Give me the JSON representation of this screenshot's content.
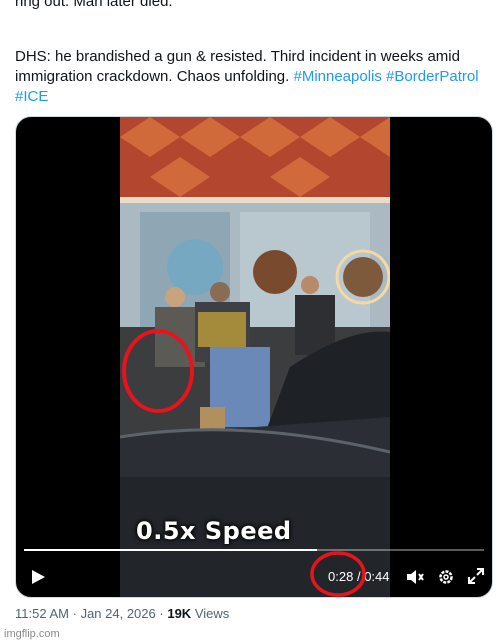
{
  "tweet": {
    "line_cut": "ring out. Man later died.",
    "para2_text": "DHS: he brandished a gun & resisted. Third incident in weeks amid immigration crackdown. Chaos unfolding.",
    "hashtags": [
      "#Minneapolis",
      "#BorderPatrol",
      "#ICE"
    ]
  },
  "video": {
    "overlay_text": "0.5x Speed",
    "current_time": "0:28",
    "separator": "/",
    "duration": "0:44",
    "progress": 0.636,
    "icons": {
      "play": "play-icon",
      "volume": "volume-icon",
      "settings": "gear-icon",
      "fullscreen": "expand-icon"
    },
    "annotation_color": "#e8131b"
  },
  "meta": {
    "time": "11:52 AM",
    "dot": "·",
    "date": "Jan 24, 2026",
    "dot2": "·",
    "views_count": "19K",
    "views_label": "Views"
  },
  "watermark": "imgflip.com",
  "colors": {
    "link": "#1d9bf0",
    "text": "#0f1419",
    "secondary": "#536471"
  }
}
